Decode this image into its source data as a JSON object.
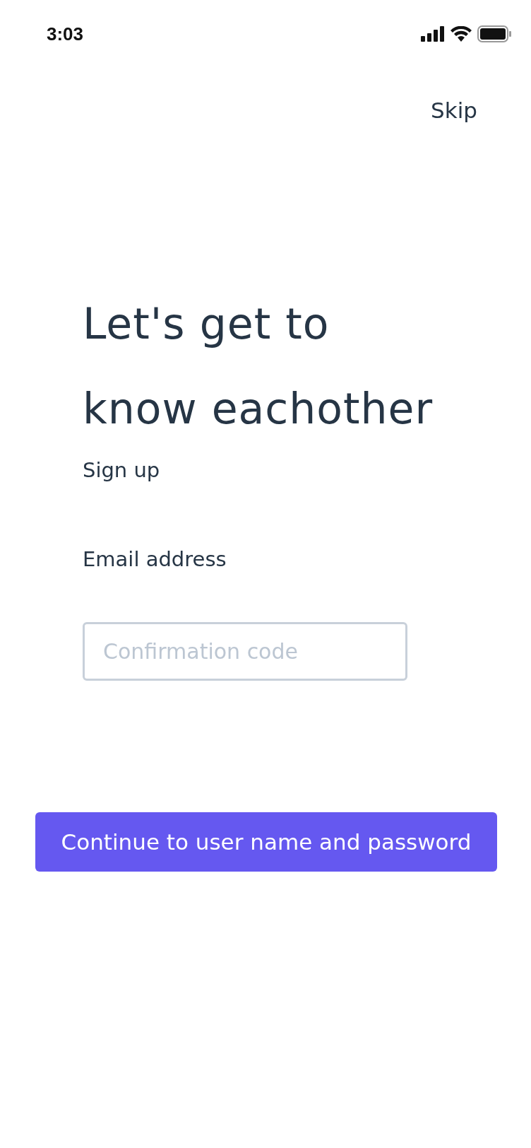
{
  "status_bar": {
    "time": "3:03"
  },
  "skip": "Skip",
  "heading": [
    "Let's get to",
    "know eachother"
  ],
  "subtitle": "Sign up",
  "email_label": "Email address",
  "code_field": {
    "placeholder": "Confirmation code"
  },
  "continue_button": "Continue to user name and password"
}
